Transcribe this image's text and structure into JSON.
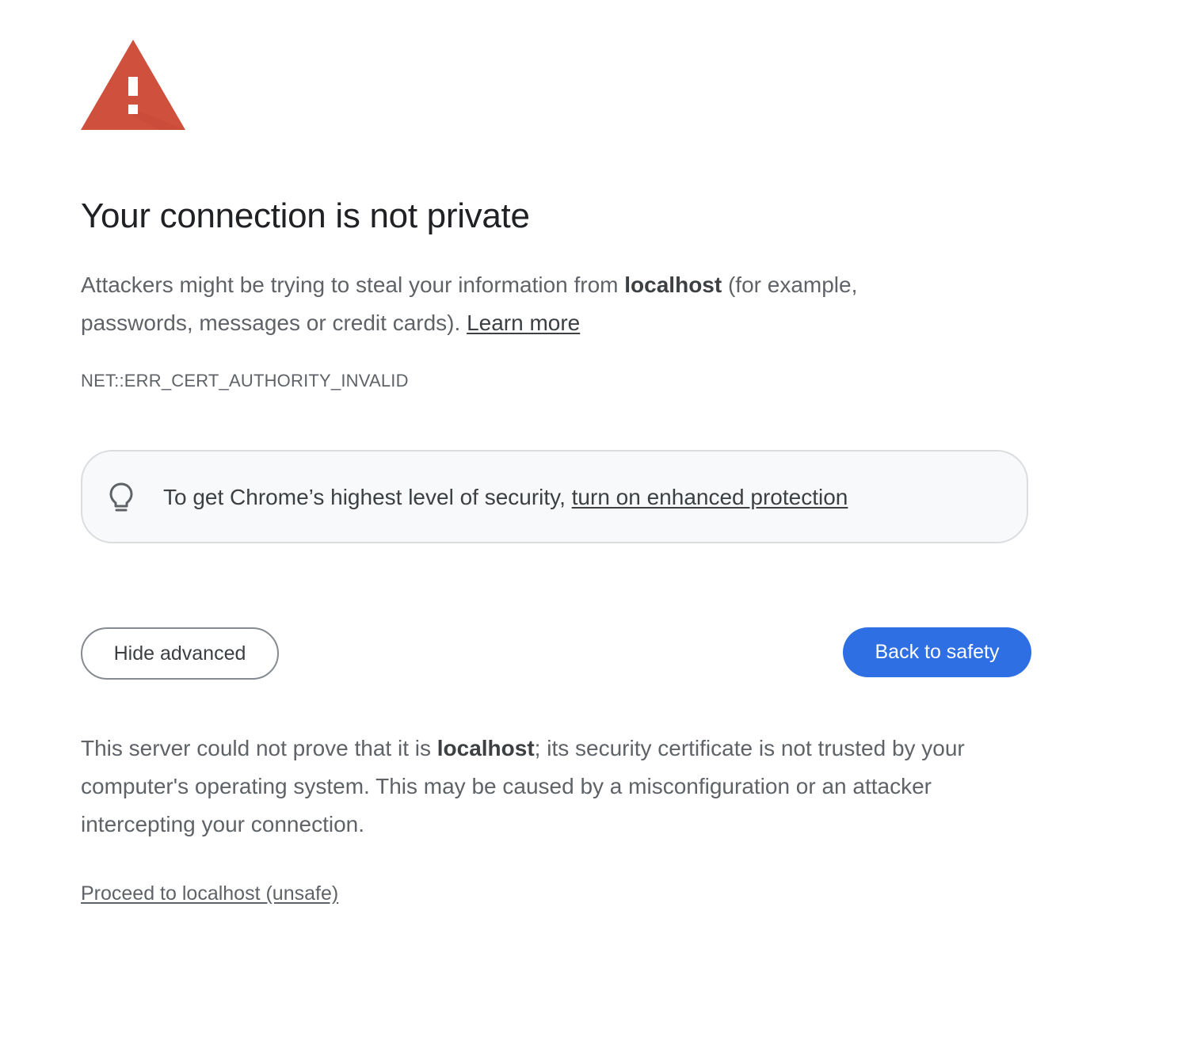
{
  "page": {
    "heading": "Your connection is not private",
    "intro": {
      "before_host": "Attackers might be trying to steal your information from ",
      "host": "localhost",
      "after_host": " (for example, passwords, messages or credit cards). ",
      "learn_more": "Learn more"
    },
    "error_code": "NET::ERR_CERT_AUTHORITY_INVALID"
  },
  "enhanced_protection": {
    "icon": "lightbulb-icon",
    "text": "To get Chrome’s highest level of security, ",
    "link": "turn on enhanced protection"
  },
  "buttons": {
    "hide_advanced": "Hide advanced",
    "back_to_safety": "Back to safety"
  },
  "details": {
    "before_host": "This server could not prove that it is ",
    "host": "localhost",
    "after_host": "; its security certificate is not trusted by your computer's operating system. This may be caused by a misconfiguration or an attacker intercepting your connection.",
    "proceed_link": "Proceed to localhost (unsafe)"
  },
  "colors": {
    "warning_icon": "#d0503e",
    "primary_button": "#2f6fe4",
    "heading_text": "#202124",
    "body_text": "#5f6368",
    "info_box_background": "#f8f9fa"
  }
}
